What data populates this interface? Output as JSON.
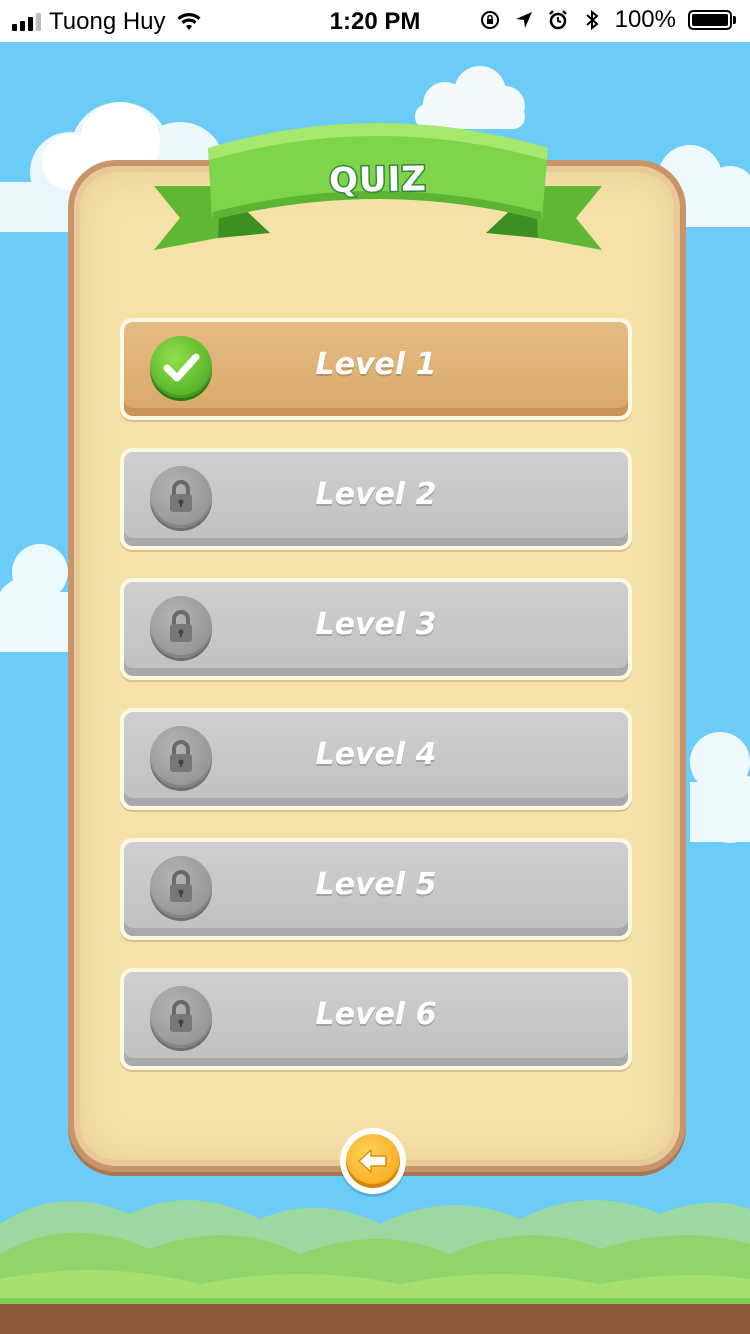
{
  "status_bar": {
    "carrier": "Tuong Huy",
    "time": "1:20 PM",
    "battery": "100%"
  },
  "title": "QUIZ",
  "levels": [
    {
      "label": "Level 1",
      "state": "completed",
      "icon": "check-icon"
    },
    {
      "label": "Level 2",
      "state": "locked",
      "icon": "lock-icon"
    },
    {
      "label": "Level 3",
      "state": "locked",
      "icon": "lock-icon"
    },
    {
      "label": "Level 4",
      "state": "locked",
      "icon": "lock-icon"
    },
    {
      "label": "Level 5",
      "state": "locked",
      "icon": "lock-icon"
    },
    {
      "label": "Level 6",
      "state": "locked",
      "icon": "lock-icon"
    }
  ],
  "back_button": {
    "icon": "back-arrow-icon"
  },
  "colors": {
    "sky": "#6cccf8",
    "panel": "#f4e2a8",
    "ribbon": "#7ed44a",
    "completed_level": "#dfb277",
    "locked_level": "#c6c6c6",
    "back_button": "#f7ad16"
  }
}
